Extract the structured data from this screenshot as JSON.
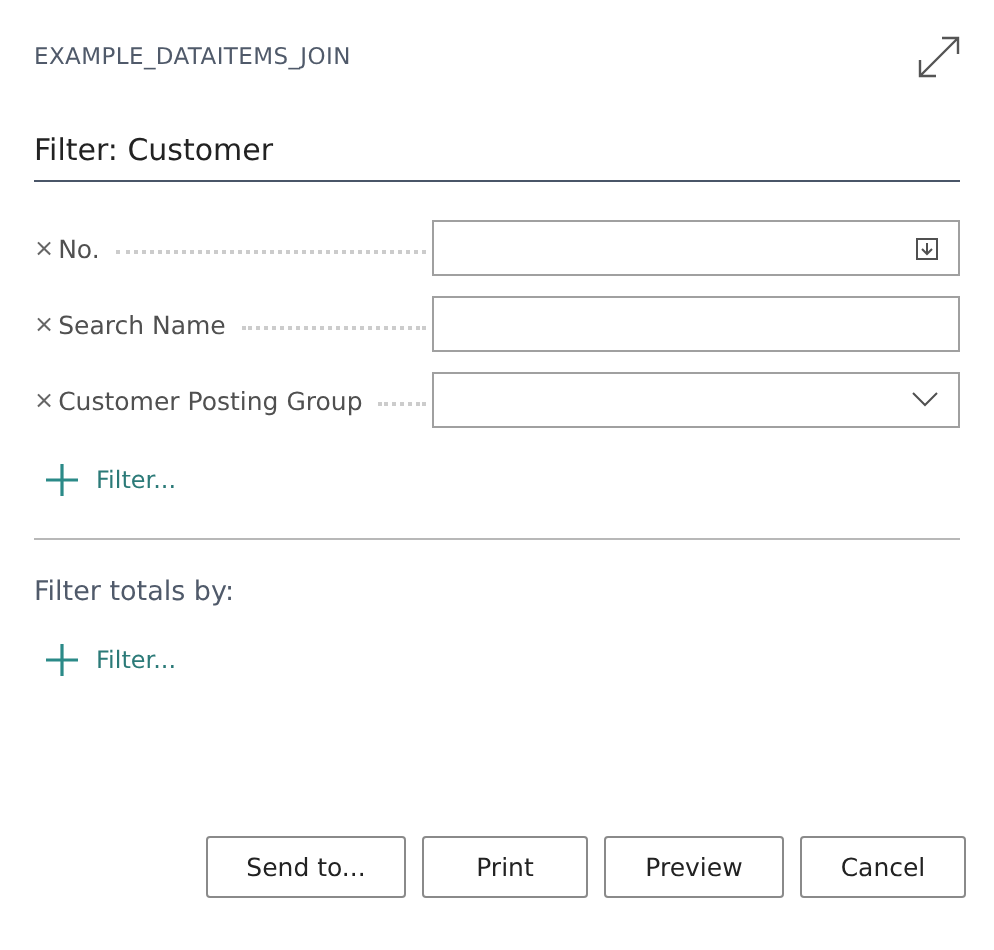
{
  "window": {
    "title": "EXAMPLE_DATAITEMS_JOIN"
  },
  "filter_section": {
    "heading": "Filter: Customer",
    "fields": [
      {
        "label": "No.",
        "kind": "lookup",
        "remove_icon": "×"
      },
      {
        "label": "Search Name",
        "kind": "text",
        "remove_icon": "×"
      },
      {
        "label": "Customer Posting Group",
        "kind": "dropdown",
        "remove_icon": "×"
      }
    ],
    "add_filter": "Filter..."
  },
  "totals_section": {
    "heading": "Filter totals by:",
    "add_filter": "Filter..."
  },
  "buttons": [
    "Send to...",
    "Print",
    "Preview",
    "Cancel"
  ]
}
